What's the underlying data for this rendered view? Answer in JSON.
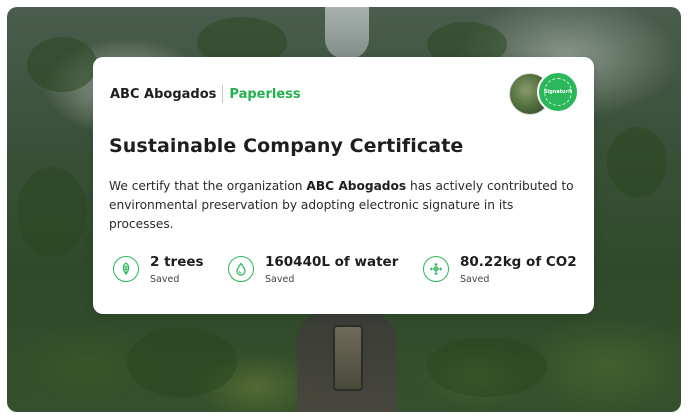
{
  "certificate": {
    "company_name": "ABC Abogados",
    "product_name": "Paperless",
    "seal_text": "Signaturit",
    "title": "Sustainable Company Certificate",
    "body_prefix": "We certify that the organization ",
    "body_company": "ABC Abogados",
    "body_suffix": " has actively contributed to environmental preservation by adopting electronic signature in its processes.",
    "stats": [
      {
        "value": "2 trees",
        "label": "Saved",
        "icon": "leaf-icon"
      },
      {
        "value": "160440L of water",
        "label": "Saved",
        "icon": "water-drop-icon"
      },
      {
        "value": "80.22kg of CO2",
        "label": "Saved",
        "icon": "co2-icon"
      }
    ]
  },
  "colors": {
    "accent_green": "#22b24c",
    "text_dark": "#1e1e1e"
  }
}
